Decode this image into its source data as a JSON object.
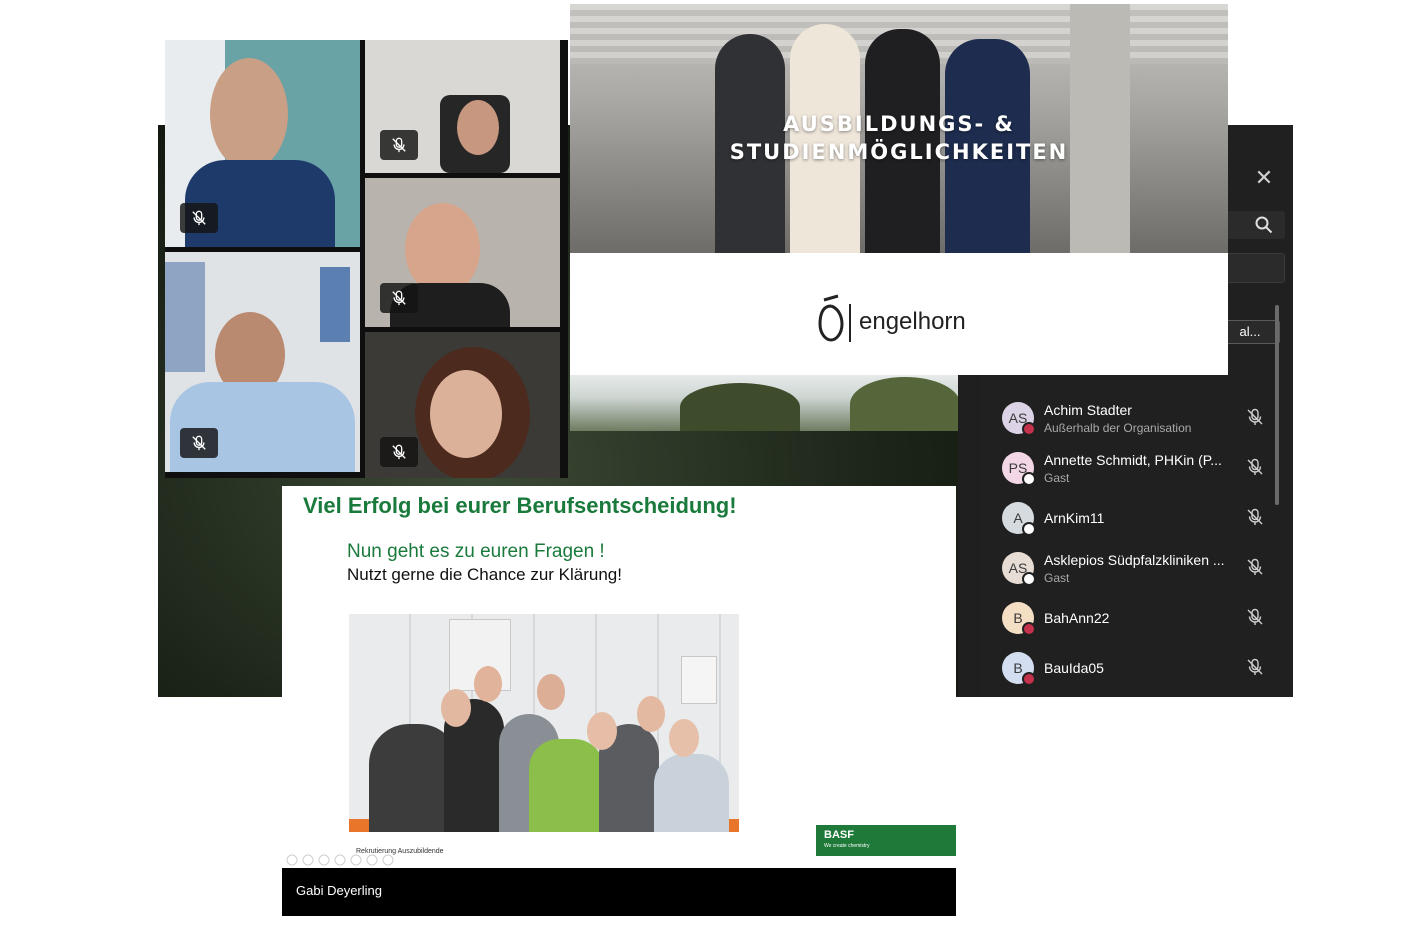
{
  "participants_panel": {
    "close_icon": "close-icon",
    "search_icon": "search-icon",
    "button_label": "al...",
    "participants": [
      {
        "initials": "AS",
        "name": "Achim Stadter",
        "subtitle": "Außerhalb der Organisation",
        "avatar_color": "#dcd3e6",
        "status_color": "#c4314b"
      },
      {
        "initials": "PS",
        "name": "Annette Schmidt, PHKin (P...",
        "subtitle": "Gast",
        "avatar_color": "#f3d7e6",
        "status_color": "#ffffff"
      },
      {
        "initials": "A",
        "name": "ArnKim11",
        "subtitle": "",
        "avatar_color": "#d6dbe0",
        "status_color": "#ffffff"
      },
      {
        "initials": "AS",
        "name": "Asklepios Südpfalzkliniken ...",
        "subtitle": "Gast",
        "avatar_color": "#e7ddd4",
        "status_color": "#ffffff"
      },
      {
        "initials": "B",
        "name": "BahAnn22",
        "subtitle": "",
        "avatar_color": "#f4dfc4",
        "status_color": "#c4314b"
      },
      {
        "initials": "B",
        "name": "BauIda05",
        "subtitle": "",
        "avatar_color": "#d3dff0",
        "status_color": "#c4314b"
      }
    ]
  },
  "engelhorn_slide": {
    "title_line1": "AUSBILDUNGS- &",
    "title_line2": "STUDIENMÖGLICHKEITEN",
    "brand": "engelhorn"
  },
  "basf_slide": {
    "heading": "Viel Erfolg bei eurer Berufsentscheidung!",
    "line1": "Nun geht es zu euren Fragen !",
    "line2": "Nutzt gerne die Chance zur Klärung!",
    "footer_text": "Rekrutierung Auszubildende",
    "logo_word": "BASF",
    "logo_tagline": "We create chemistry",
    "presenter": "Gabi Deyerling",
    "brand_color": "#1a7a3c"
  }
}
